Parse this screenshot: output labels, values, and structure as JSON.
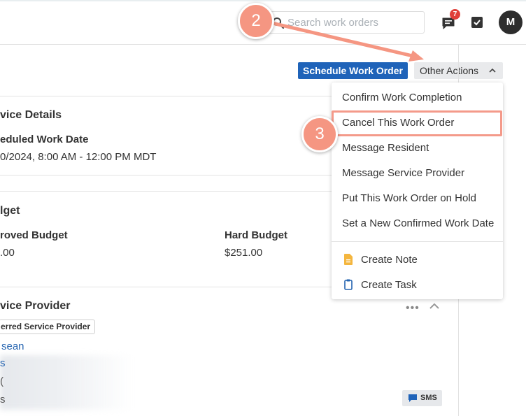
{
  "header": {
    "search_placeholder": "Search work orders",
    "notification_count": "7",
    "avatar_initial": "M"
  },
  "actions": {
    "schedule_label": "Schedule Work Order",
    "other_actions_label": "Other Actions"
  },
  "dropdown": {
    "items": [
      "Confirm Work Completion",
      "Cancel This Work Order",
      "Message Resident",
      "Message Service Provider",
      "Put This Work Order on Hold",
      "Set a New Confirmed Work Date"
    ],
    "create_note": "Create Note",
    "create_task": "Create Task",
    "highlighted_item": "Cancel This Work Order"
  },
  "service_details": {
    "title": "vice Details",
    "scheduled_label": "eduled Work Date",
    "scheduled_value": "0/2024, 8:00 AM - 12:00 PM MDT"
  },
  "budget": {
    "title": "lget",
    "approved_label": "roved Budget",
    "approved_value": ".00",
    "hard_label": "Hard Budget",
    "hard_value": "$251.00"
  },
  "service_provider": {
    "title": "vice Provider",
    "tag": "erred Service Provider",
    "name_link": "sean",
    "sms_label": "SMS",
    "more_dots": "•••"
  },
  "annotations": {
    "step_2": "2",
    "step_3": "3"
  },
  "colors": {
    "primary": "#1f63b9",
    "callout": "#f59682",
    "badge": "#e0403a",
    "link": "#2564b0"
  }
}
